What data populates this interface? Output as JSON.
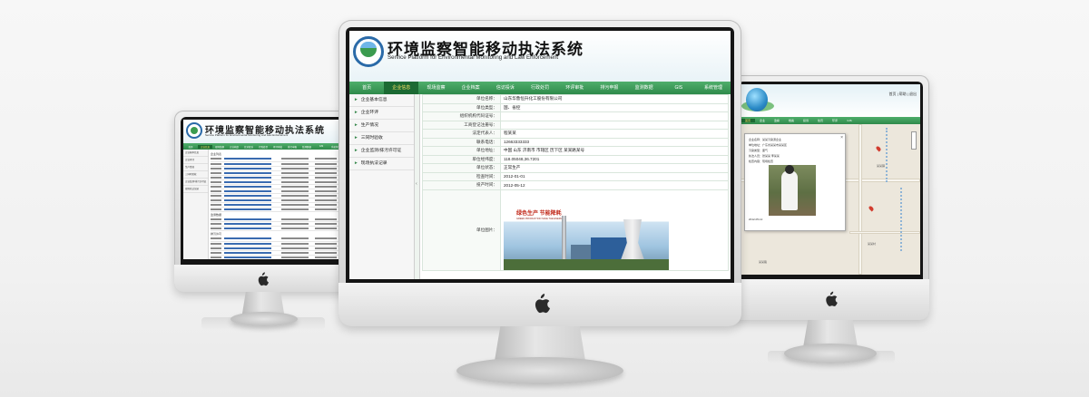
{
  "center": {
    "app_title": "环境监察智能移动执法系统",
    "app_subtitle": "Service Platform for Environmental Monitoring and Law Enforcement",
    "nav": [
      {
        "label": "首页",
        "active": false
      },
      {
        "label": "企业信息",
        "active": true
      },
      {
        "label": "现场监察",
        "active": false
      },
      {
        "label": "企业档案",
        "active": false
      },
      {
        "label": "信访投诉",
        "active": false
      },
      {
        "label": "行政处罚",
        "active": false
      },
      {
        "label": "环评审批",
        "active": false
      },
      {
        "label": "排污申报",
        "active": false
      },
      {
        "label": "监测数据",
        "active": false
      },
      {
        "label": "GIS",
        "active": false
      },
      {
        "label": "系统管理",
        "active": false
      }
    ],
    "sidebar": [
      "企业基本信息",
      "企业环评",
      "生产情况",
      "三同时验收",
      "企业监测/排污许可证",
      "现场执法记录"
    ],
    "detail": [
      {
        "label": "单位名称：",
        "value": "山东华鲁恒升化工股份有限公司"
      },
      {
        "label": "单位类型：",
        "value": "国、省控"
      },
      {
        "label": "组织机构代码证号：",
        "value": ""
      },
      {
        "label": "工商登记注册号：",
        "value": ""
      },
      {
        "label": "法定代表人：",
        "value": "程某某"
      },
      {
        "label": "联系电话：",
        "value": "12663333333"
      },
      {
        "label": "单位地址：",
        "value": "中国 山东 济南市 市辖区 历下区 某某路某号"
      },
      {
        "label": "单位经纬度：",
        "value": "118.05048,36.7201"
      },
      {
        "label": "单位状态：",
        "value": "正常生产"
      },
      {
        "label": "检查时间：",
        "value": "2012-01-01"
      },
      {
        "label": "投产时间：",
        "value": "2012-05-12"
      }
    ],
    "photo_label": "单位图片：",
    "photo_banner": "绿色生产 节能降耗",
    "photo_banner_sub": "GREEN PRODUCTION SAVE THE ENERGY"
  },
  "left": {
    "app_title": "环境监察智能移动执法系统",
    "app_subtitle": "Service Platform for Environmental Monitoring and Law Enforcement",
    "nav": [
      "首页",
      "企业信息",
      "现场监察",
      "企业档案",
      "信访投诉",
      "行政处罚",
      "环评审批",
      "排污申报",
      "监测数据",
      "GIS",
      "系统管理"
    ],
    "sidebar": [
      "企业基本信息",
      "企业环评",
      "生产情况",
      "三同时验收",
      "企业监测/排污许可证",
      "现场执法记录"
    ],
    "sections": [
      "企业列表",
      "监测数据",
      "排污许可"
    ]
  },
  "right": {
    "header_buttons": "首页 | 帮助 | 退出",
    "nav": [
      "首页",
      "企业",
      "监察",
      "档案",
      "投诉",
      "处罚",
      "环评",
      "GIS"
    ],
    "popup": {
      "rows": [
        "企业名称：某某污染源企业",
        "单位地址：广东省某某市某某区",
        "污染类型：废气",
        "执法人员：张某某 李某某",
        "检查内容：现场检查"
      ],
      "footer": "2012-05-12"
    },
    "map_labels": [
      "某某镇",
      "某某村",
      "某某路"
    ]
  },
  "colors": {
    "nav_green": "#2f8a4b",
    "nav_active": "#1c6a33",
    "nav_active_text": "#ffe36a",
    "logo_blue": "#2a6aa8"
  }
}
